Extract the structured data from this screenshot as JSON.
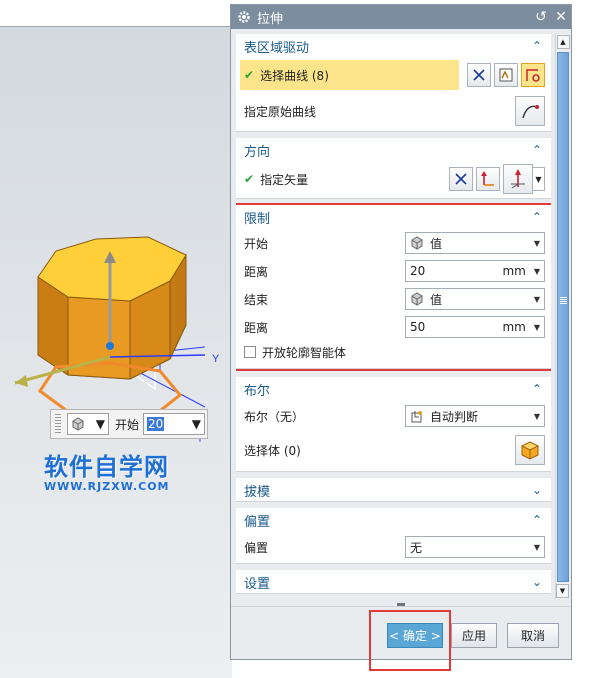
{
  "colors": {
    "accent": "#1a5a8c",
    "highlight": "#fce48b",
    "check": "#2aa33a",
    "red_box": "#e03a3a",
    "titlebar": "#7d8da0",
    "watermark": "#1e6fd6"
  },
  "dialog": {
    "title": "拉伸",
    "icons": {
      "title": "gear-icon",
      "reset": "reset-icon",
      "close": "close-icon"
    },
    "sections": {
      "surface_drive": {
        "title": "表区域驱动",
        "select_curve": "选择曲线 (8)",
        "specify_curve": "指定原始曲线"
      },
      "direction": {
        "title": "方向",
        "specify_vector": "指定矢量"
      },
      "limits": {
        "title": "限制",
        "start_label": "开始",
        "start_value": "值",
        "start_dist_label": "距离",
        "start_dist": "20",
        "end_label": "结束",
        "end_value": "值",
        "end_dist_label": "距离",
        "end_dist": "50",
        "unit": "mm",
        "open_profile": "开放轮廓智能体"
      },
      "boolean": {
        "title": "布尔",
        "label": "布尔（无）",
        "value": "自动判断",
        "select_body": "选择体 (0)"
      },
      "draft": {
        "title": "拔模"
      },
      "offset": {
        "title": "偏置",
        "label": "偏置",
        "value": "无"
      },
      "settings": {
        "title": "设置"
      }
    },
    "buttons": {
      "ok": "< 确定 >",
      "apply": "应用",
      "cancel": "取消"
    }
  },
  "viewport": {
    "mini_toolbar": {
      "label": "开始",
      "value": "20"
    },
    "axis_label": "Y",
    "axis_label_small": "Y",
    "watermark_title": "软件自学网",
    "watermark_url": "WWW.RJZXW.COM"
  }
}
